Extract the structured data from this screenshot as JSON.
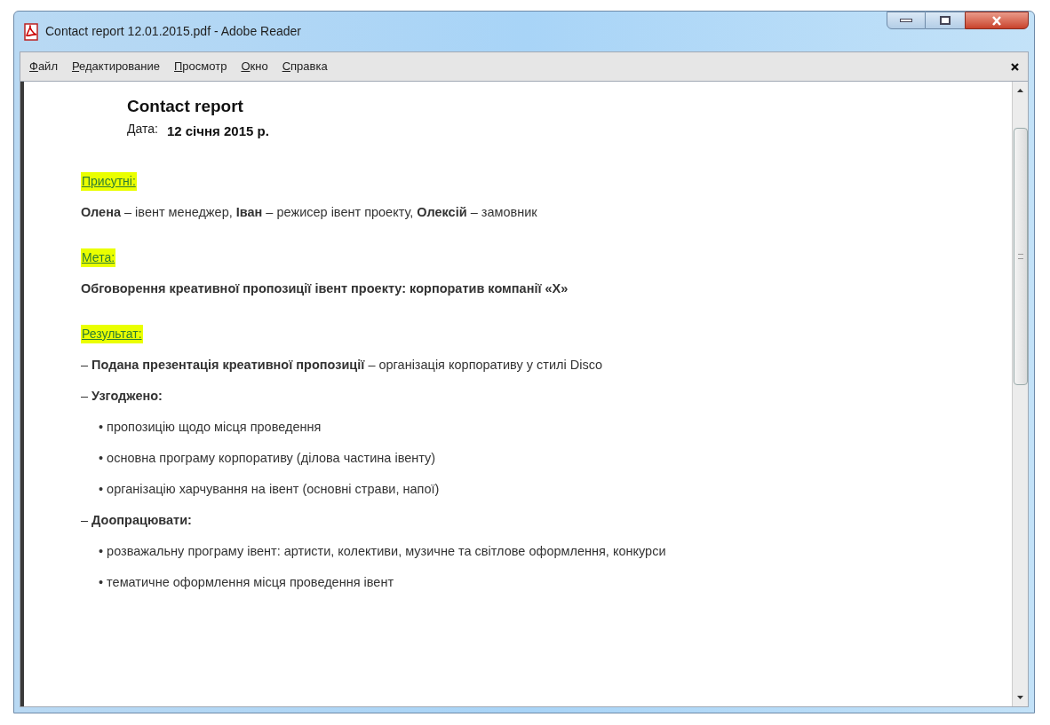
{
  "window": {
    "title": "Contact report 12.01.2015.pdf - Adobe Reader"
  },
  "menu": [
    {
      "label": "Файл"
    },
    {
      "label": "Редактирование"
    },
    {
      "label": "Просмотр"
    },
    {
      "label": "Окно"
    },
    {
      "label": "Справка"
    }
  ],
  "document": {
    "title": "Contact report",
    "date_label": "Дата:",
    "date_value": "12 січня  2015 р.",
    "sections": [
      {
        "heading": "Присутні:",
        "lines": [
          {
            "kind": "plain",
            "text": "**Олена** – івент менеджер, **Іван** – режисер івент проекту, **Олексій** – замовник"
          }
        ]
      },
      {
        "heading": "Мета:",
        "lines": [
          {
            "kind": "plain",
            "text": "**Обговорення креативної пропозиції івент проекту: корпоратив компанії «Х»**"
          }
        ]
      },
      {
        "heading": "Результат:",
        "lines": [
          {
            "kind": "plain",
            "text": "– **Подана презентація креативної пропозиції** – організація корпоративу у стилі Disco"
          },
          {
            "kind": "plain",
            "text": "– **Узгоджено:**"
          },
          {
            "kind": "sub",
            "text": "•  пропозицію щодо місця проведення"
          },
          {
            "kind": "sub",
            "text": "•  основна програму корпоративу (ділова частина івенту)"
          },
          {
            "kind": "sub",
            "text": "• організацію харчування на івент (основні страви, напої)"
          },
          {
            "kind": "plain",
            "text": "– **Доопрацювати:**"
          },
          {
            "kind": "sub",
            "text": "• розважальну програму івент: артисти,  колективи, музичне  та світлове оформлення, конкурси"
          },
          {
            "kind": "sub",
            "text": "• тематичне оформлення місця проведення івент"
          }
        ]
      }
    ]
  }
}
